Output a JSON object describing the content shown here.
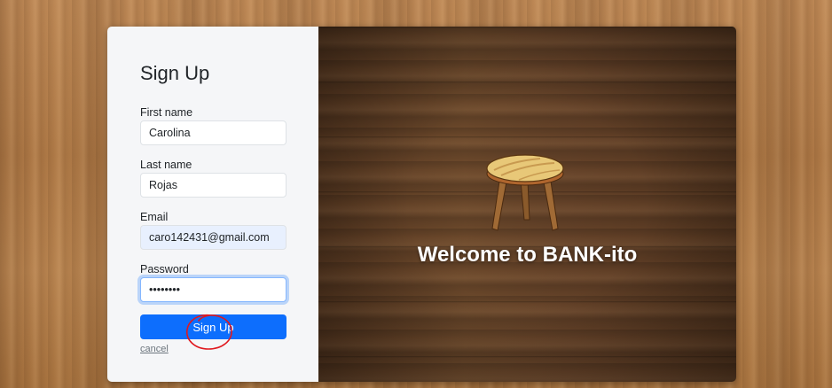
{
  "signup": {
    "title": "Sign Up",
    "first_name": {
      "label": "First name",
      "value": "Carolina"
    },
    "last_name": {
      "label": "Last name",
      "value": "Rojas"
    },
    "email": {
      "label": "Email",
      "value": "caro142431@gmail.com"
    },
    "password": {
      "label": "Password",
      "value": "••••••••"
    },
    "submit_label": "Sign Up",
    "cancel_label": "cancel"
  },
  "welcome": {
    "message": "Welcome to BANK-ito",
    "logo_icon": "stool-icon"
  },
  "colors": {
    "primary": "#0d6efd",
    "annotation": "#e0181e",
    "form_bg": "#f5f6f8"
  }
}
